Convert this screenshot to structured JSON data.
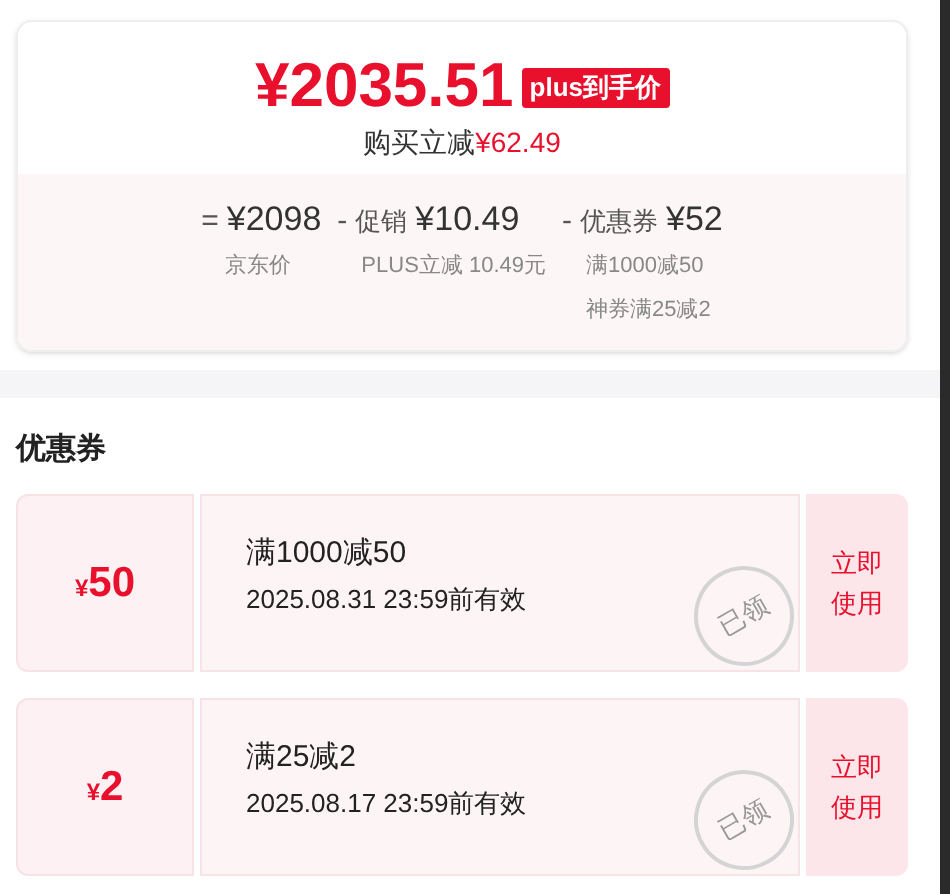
{
  "price_card": {
    "price": "¥2035.51",
    "badge": "plus到手价",
    "saving_label": "购买立减",
    "saving_amount": "¥62.49",
    "breakdown": [
      {
        "sign": "=",
        "amount": "¥2098",
        "notes": [
          "京东价"
        ]
      },
      {
        "sign": "-",
        "label": "促销",
        "amount": "¥10.49",
        "notes": [
          "PLUS立减 10.49元"
        ]
      },
      {
        "sign": "-",
        "label": "优惠券",
        "amount": "¥52",
        "notes": [
          "满1000减50",
          "神券满25减2"
        ]
      }
    ]
  },
  "coupons_section": {
    "title": "优惠券",
    "coupons": [
      {
        "currency": "¥",
        "value": "50",
        "condition": "满1000减50",
        "validity": "2025.08.31 23:59前有效",
        "stamp": "已领",
        "claimed": true,
        "action": "立即使用"
      },
      {
        "currency": "¥",
        "value": "2",
        "condition": "满25减2",
        "validity": "2025.08.17 23:59前有效",
        "stamp": "已领",
        "claimed": true,
        "action": "立即使用"
      }
    ]
  }
}
